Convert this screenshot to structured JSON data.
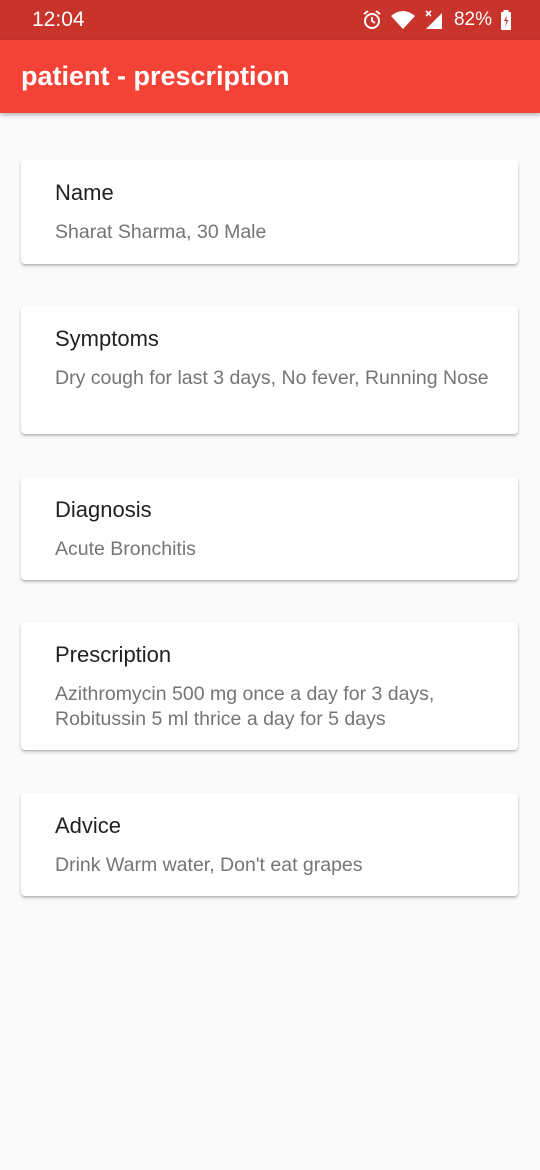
{
  "status_bar": {
    "time": "12:04",
    "battery": "82%",
    "icons": [
      "alarm-icon",
      "wifi-icon",
      "signal-icon",
      "battery-icon"
    ]
  },
  "app_bar": {
    "title": "patient - prescription",
    "color": "#f44336",
    "status_color": "#c8332b"
  },
  "cards": {
    "name": {
      "title": "Name",
      "value": "Sharat Sharma, 30 Male"
    },
    "symptoms": {
      "title": "Symptoms",
      "value": "Dry cough for last 3 days, No fever, Running Nose"
    },
    "diagnosis": {
      "title": "Diagnosis",
      "value": "Acute Bronchitis"
    },
    "prescription": {
      "title": "Prescription",
      "value": "Azithromycin 500 mg once a day for 3 days, Robitussin 5 ml thrice a day for 5 days"
    },
    "advice": {
      "title": "Advice",
      "value": "Drink Warm water, Don't eat grapes"
    }
  }
}
